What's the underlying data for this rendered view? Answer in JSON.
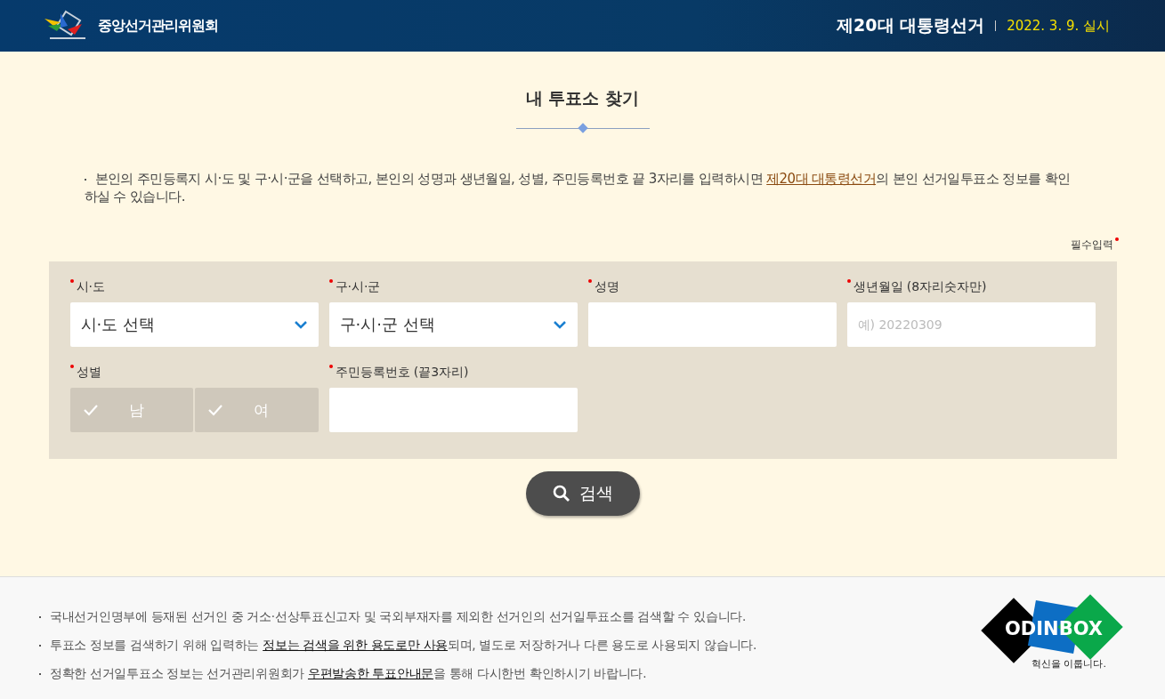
{
  "header": {
    "org_name": "중앙선거관리위원회",
    "election_title": "제20대 대통령선거",
    "election_date": "2022. 3. 9. 실시"
  },
  "page_title": "내 투표소 찾기",
  "intro": {
    "before": "본인의 주민등록지 시·도 및 구·시·군을 선택하고, 본인의 성명과 생년월일, 성별, 주민등록번호 끝 3자리를 입력하시면 ",
    "link": "제20대 대통령선거",
    "after": "의 본인 선거일투표소 정보를 확인하실 수 있습니다."
  },
  "required_note": "필수입력",
  "fields": [
    {
      "kind": "select",
      "label": "시·도",
      "required": true,
      "value": "시·도 선택"
    },
    {
      "kind": "select",
      "label": "구·시·군",
      "required": true,
      "value": "구·시·군 선택"
    },
    {
      "kind": "text",
      "label": "성명",
      "required": true
    },
    {
      "kind": "text",
      "label": "생년월일",
      "hint": "(8자리숫자만)",
      "required": true,
      "placeholder": "예) 20220309"
    },
    {
      "kind": "gender",
      "label": "성별",
      "required": true,
      "options": [
        {
          "label": "남",
          "selected": false
        },
        {
          "label": "여",
          "selected": false
        }
      ]
    },
    {
      "kind": "text",
      "label": "주민등록번호",
      "hint": "(끝3자리)",
      "required": true
    }
  ],
  "search_button": "검색",
  "notes": [
    {
      "before": "국내선거인명부에 등재된 선거인 중 거소·선상투표신고자 및 국외부재자를 제외한 선거인의 선거일투표소를 검색할 수 있습니다."
    },
    {
      "before": "투표소 정보를 검색하기 위해 입력하는 ",
      "link": "정보는 검색을 위한 용도로만 사용",
      "after": "되며, 별도로 저장하거나 다른 용도로 사용되지 않습니다."
    },
    {
      "before": "정확한 선거일투표소 정보는 선거관리위원회가 ",
      "link": "우편발송한 투표안내문",
      "after": "을 통해 다시한번 확인하시기 바랍니다."
    }
  ],
  "footer_logo": {
    "name": "ODINBOX",
    "slogan": "혁신을 이룹니다."
  }
}
